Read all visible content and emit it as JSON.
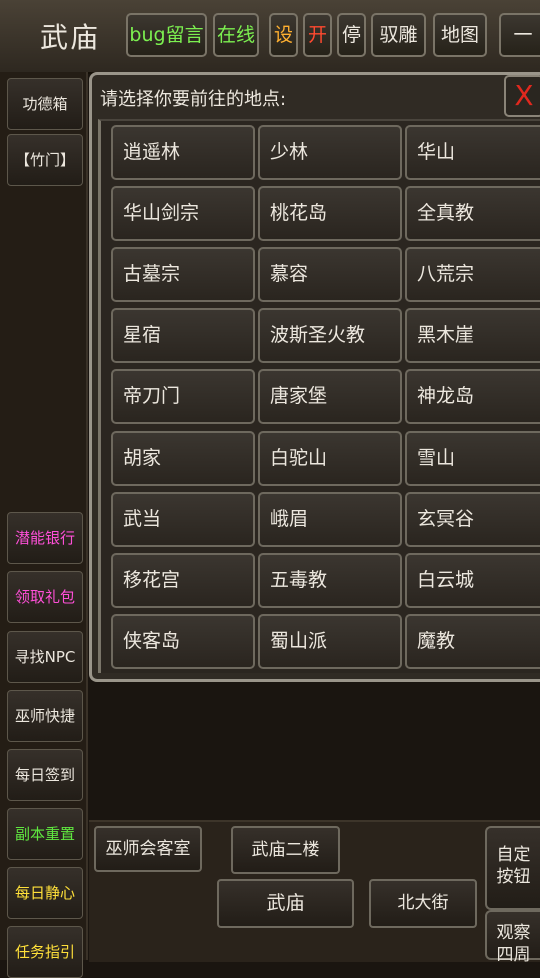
{
  "header": {
    "title": "武庙",
    "buttons": [
      {
        "label": "bug留言",
        "color": "#7cf050"
      },
      {
        "label": "在线",
        "color": "#7cf050"
      },
      {
        "label": "设",
        "color": "#ffb030"
      },
      {
        "label": "开",
        "color": "#ff4a30"
      },
      {
        "label": "停"
      },
      {
        "label": "驭雕"
      },
      {
        "label": "地图"
      },
      {
        "label": "一"
      }
    ]
  },
  "sidebar": {
    "top_items": [
      "功德箱",
      "【竹门】"
    ],
    "items": [
      {
        "label": "潜能银行",
        "color": "#ff4fd8"
      },
      {
        "label": "领取礼包",
        "color": "#ff4fd8"
      },
      {
        "label": "寻找NPC"
      },
      {
        "label": "巫师快捷"
      },
      {
        "label": "每日签到"
      },
      {
        "label": "副本重置",
        "color": "#60e840"
      },
      {
        "label": "每日静心",
        "color": "#ffe03a"
      },
      {
        "label": "任务指引",
        "color": "#ffe03a"
      }
    ]
  },
  "modal": {
    "prompt": "请选择你要前往的地点:",
    "close_label": "X",
    "locations": [
      [
        "逍遥林",
        "少林",
        "华山"
      ],
      [
        "华山剑宗",
        "桃花岛",
        "全真教"
      ],
      [
        "古墓宗",
        "慕容",
        "八荒宗"
      ],
      [
        "星宿",
        "波斯圣火教",
        "黑木崖"
      ],
      [
        "帝刀门",
        "唐家堡",
        "神龙岛"
      ],
      [
        "胡家",
        "白驼山",
        "雪山"
      ],
      [
        "武当",
        "峨眉",
        "玄冥谷"
      ],
      [
        "移花宫",
        "五毒教",
        "白云城"
      ],
      [
        "侠客岛",
        "蜀山派",
        "魔教"
      ]
    ]
  },
  "exits": {
    "wizard_room": "巫师会客室",
    "upstairs": "武庙二楼",
    "current": "武庙",
    "north_street": "北大街"
  },
  "right_buttons": {
    "custom": [
      "自定",
      "按钮"
    ],
    "observe": [
      "观察",
      "四周"
    ]
  }
}
